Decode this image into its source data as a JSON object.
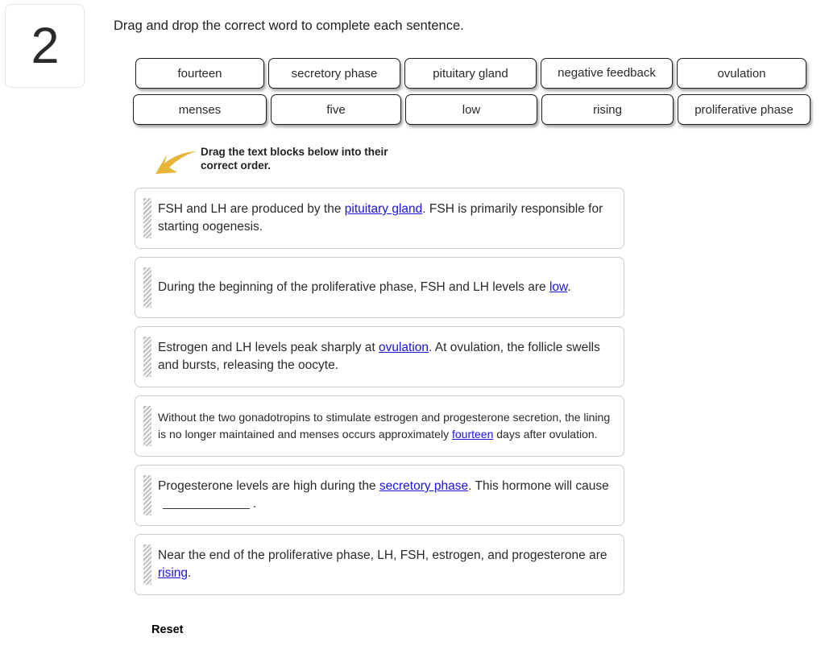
{
  "question": {
    "number": "2",
    "prompt": "Drag and drop the correct word to complete each sentence."
  },
  "word_bank": {
    "rows": [
      [
        {
          "label": "fourteen"
        },
        {
          "label": "secretory phase"
        },
        {
          "label": "pituitary gland"
        },
        {
          "label": "negative feedback"
        },
        {
          "label": "ovulation"
        }
      ],
      [
        {
          "label": "menses"
        },
        {
          "label": "five"
        },
        {
          "label": "low"
        },
        {
          "label": "rising"
        },
        {
          "label": "proliferative phase"
        }
      ]
    ]
  },
  "hint": {
    "text": "Drag the text blocks below into their\ncorrect order.",
    "arrow_color": "#e8b437"
  },
  "sentences": [
    {
      "parts": [
        {
          "type": "text",
          "value": "FSH and LH are produced by the "
        },
        {
          "type": "dropped",
          "value": "pituitary gland"
        },
        {
          "type": "text",
          "value": ". FSH is primarily responsible for starting oogenesis."
        }
      ]
    },
    {
      "parts": [
        {
          "type": "text",
          "value": "During the beginning of the proliferative phase, FSH and LH levels are "
        },
        {
          "type": "dropped",
          "value": "low"
        },
        {
          "type": "text",
          "value": "."
        }
      ]
    },
    {
      "parts": [
        {
          "type": "text",
          "value": "Estrogen and LH levels peak sharply at "
        },
        {
          "type": "dropped",
          "value": "ovulation"
        },
        {
          "type": "text",
          "value": ". At ovulation, the follicle swells and bursts, releasing the oocyte."
        }
      ]
    },
    {
      "small": true,
      "parts": [
        {
          "type": "text",
          "value": "Without the two gonadotropins to stimulate estrogen and progesterone secretion, the lining is no longer maintained and menses occurs approximately "
        },
        {
          "type": "dropped",
          "value": "fourteen"
        },
        {
          "type": "text",
          "value": " days after ovulation."
        }
      ]
    },
    {
      "parts": [
        {
          "type": "text",
          "value": "Progesterone levels are high during the "
        },
        {
          "type": "dropped",
          "value": "secretory phase"
        },
        {
          "type": "text",
          "value": ". This hormone will cause"
        },
        {
          "type": "blank",
          "value": ""
        },
        {
          "type": "text",
          "value": "."
        }
      ]
    },
    {
      "parts": [
        {
          "type": "text",
          "value": "Near the end of the proliferative phase, LH, FSH, estrogen, and progesterone are "
        },
        {
          "type": "dropped",
          "value": "rising"
        },
        {
          "type": "text",
          "value": "."
        }
      ]
    }
  ],
  "controls": {
    "reset_label": "Reset"
  },
  "colors": {
    "dropped_word": "#1a14d8",
    "tile_border": "#1c1c1c",
    "block_border": "#cccccc",
    "arrow": "#e8b437"
  }
}
